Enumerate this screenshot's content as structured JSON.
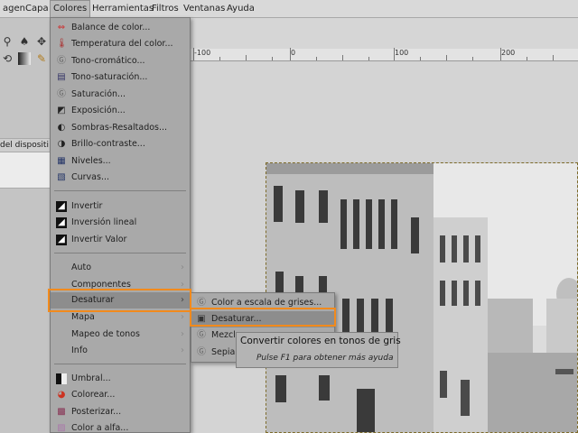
{
  "menubar": {
    "items": [
      "agen",
      "Capa",
      "Colores",
      "Herramientas",
      "Filtros",
      "Ventanas",
      "Ayuda"
    ],
    "active": "Colores"
  },
  "toolbox": {
    "device_tab_label": "del dispositi"
  },
  "ruler": {
    "labels": [
      "-100",
      "0",
      "100",
      "200"
    ]
  },
  "colors_menu": {
    "group1": [
      {
        "label": "Balance de color...",
        "icon": "color-balance-icon"
      },
      {
        "label": "Temperatura del color...",
        "icon": "thermometer-icon"
      },
      {
        "label": "Tono-cromático...",
        "icon": "hue-chroma-icon"
      },
      {
        "label": "Tono-saturación...",
        "icon": "hue-saturation-icon"
      },
      {
        "label": "Saturación...",
        "icon": "saturation-icon"
      },
      {
        "label": "Exposición...",
        "icon": "exposure-icon"
      },
      {
        "label": "Sombras-Resaltados...",
        "icon": "shadows-highlights-icon"
      },
      {
        "label": "Brillo-contraste...",
        "icon": "brightness-contrast-icon"
      },
      {
        "label": "Niveles...",
        "icon": "levels-icon"
      },
      {
        "label": "Curvas...",
        "icon": "curves-icon"
      }
    ],
    "group2": [
      {
        "label": "Invertir",
        "icon": "invert-icon"
      },
      {
        "label": "Inversión lineal",
        "icon": "linear-invert-icon"
      },
      {
        "label": "Invertir Valor",
        "icon": "value-invert-icon"
      }
    ],
    "group3": [
      {
        "label": "Auto",
        "submenu": true
      },
      {
        "label": "Componentes",
        "submenu": true
      },
      {
        "label": "Desaturar",
        "submenu": true,
        "selected": true
      },
      {
        "label": "Mapa",
        "submenu": true
      },
      {
        "label": "Mapeo de tonos",
        "submenu": true
      },
      {
        "label": "Info",
        "submenu": true
      }
    ],
    "group4": [
      {
        "label": "Umbral...",
        "icon": "threshold-icon"
      },
      {
        "label": "Colorear...",
        "icon": "colorize-icon"
      },
      {
        "label": "Posterizar...",
        "icon": "posterize-icon"
      },
      {
        "label": "Color a alfa...",
        "icon": "color-to-alpha-icon"
      }
    ]
  },
  "desaturate_submenu": {
    "items": [
      {
        "label": "Color a escala de grises...",
        "icon": "gegl-icon"
      },
      {
        "label": "Desaturar...",
        "icon": "desaturate-icon",
        "selected": true
      },
      {
        "label": "Mezcla",
        "icon": "mixer-icon"
      },
      {
        "label": "Sepia...",
        "icon": "sepia-icon"
      }
    ]
  },
  "tooltip": {
    "text": "Convertir colores en tonos de gris",
    "help": "Pulse F1 para obtener más ayuda"
  },
  "colors": {
    "highlight": "#f28a1c",
    "menu_bg": "#a9a9a9",
    "selection_bg": "#8d8d8d"
  }
}
